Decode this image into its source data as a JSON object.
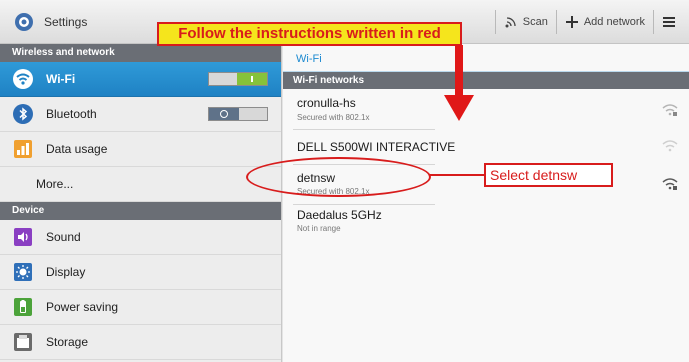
{
  "actionbar": {
    "title": "Settings",
    "scan_label": "Scan",
    "add_network_label": "Add network"
  },
  "banner": {
    "text": "Follow the instructions written in red"
  },
  "left_pane": {
    "section_wireless": "Wireless and network",
    "wifi_label": "Wi-Fi",
    "bluetooth_label": "Bluetooth",
    "data_usage_label": "Data usage",
    "more_label": "More...",
    "section_device": "Device",
    "sound_label": "Sound",
    "display_label": "Display",
    "power_saving_label": "Power saving",
    "storage_label": "Storage"
  },
  "toggles": {
    "wifi_on": true,
    "bluetooth_on": false
  },
  "right_pane": {
    "title": "Wi-Fi",
    "networks_header": "Wi-Fi networks",
    "networks": [
      {
        "name": "cronulla-hs",
        "status": "Secured with 802.1x",
        "secured": true
      },
      {
        "name": "DELL S500WI INTERACTIVE",
        "status": "",
        "secured": false
      },
      {
        "name": "detnsw",
        "status": "Secured with 802.1x",
        "secured": true
      },
      {
        "name": "Daedalus 5GHz",
        "status": "Not in range",
        "secured": false
      }
    ]
  },
  "annotation": {
    "callout_text": "Select  detnsw"
  },
  "colors": {
    "accent": "#1f82c4",
    "annotation_red": "#d81c1c",
    "banner_yellow": "#f5e51c",
    "section_header": "#6a6e75",
    "toggle_on": "#86c23a"
  },
  "icons": {
    "app": "settings-icon",
    "scan": "scan-icon",
    "add": "plus-icon",
    "menu": "menu-icon",
    "signal": "wifi-signal-icon"
  }
}
